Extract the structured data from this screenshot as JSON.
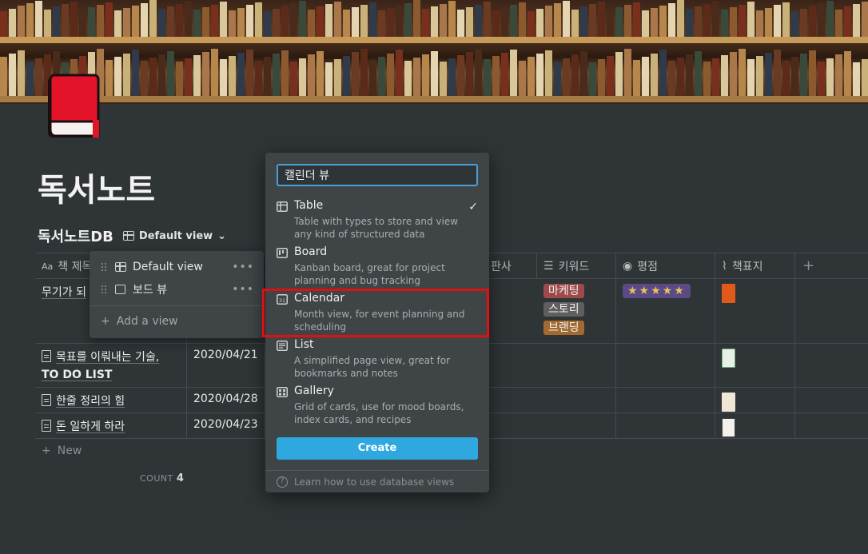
{
  "page": {
    "title": "독서노트"
  },
  "database": {
    "title": "독서노트DB",
    "current_view": "Default view"
  },
  "columns": [
    "책 제목",
    "판사",
    "키워드",
    "평점",
    "책표지"
  ],
  "rows": [
    {
      "title": "무기가 되",
      "date": "",
      "tags": [
        "마케팅",
        "스토리",
        "브랜딩"
      ],
      "rating": "★★★★★"
    },
    {
      "title_line1": "목표를 이뤄내는 기술,",
      "title_line2": "TO DO LIST",
      "date": "2020/04/21"
    },
    {
      "title": "한줄 정리의 힘",
      "date": "2020/04/28"
    },
    {
      "title": "돈 일하게 하라",
      "date": "2020/04/23"
    }
  ],
  "table_footer": {
    "new_label": "New",
    "count_label": "COUNT",
    "count_value": "4"
  },
  "views_menu": {
    "items": [
      {
        "label": "Default view",
        "icon": "table-icon"
      },
      {
        "label": "보드 뷰",
        "icon": "board-icon"
      }
    ],
    "add_label": "Add a view"
  },
  "add_view": {
    "search_value": "캘린더 뷰",
    "types": [
      {
        "label": "Table",
        "desc": "Table with types to store and view any kind of structured data",
        "icon": "table-icon",
        "selected": true
      },
      {
        "label": "Board",
        "desc": "Kanban board, great for project planning and bug tracking",
        "icon": "board-icon"
      },
      {
        "label": "Calendar",
        "desc": "Month view, for event planning and scheduling",
        "icon": "calendar-icon"
      },
      {
        "label": "List",
        "desc": "A simplified page view, great for bookmarks and notes",
        "icon": "list-icon"
      },
      {
        "label": "Gallery",
        "desc": "Grid of cards, use for mood boards, index cards, and recipes",
        "icon": "gallery-icon"
      }
    ],
    "create_label": "Create",
    "footer_text": "Learn how to use database views",
    "calendar_icon_text": "31"
  },
  "colors": {
    "background": "#2f3437",
    "menu": "#3f4447",
    "accent": "#2ea8df",
    "highlight": "#e01010",
    "tag_marketing": "#9e4a4a",
    "tag_story": "#5f5f5f",
    "tag_branding": "#a36a30",
    "rating_bg": "#5b4a85"
  }
}
